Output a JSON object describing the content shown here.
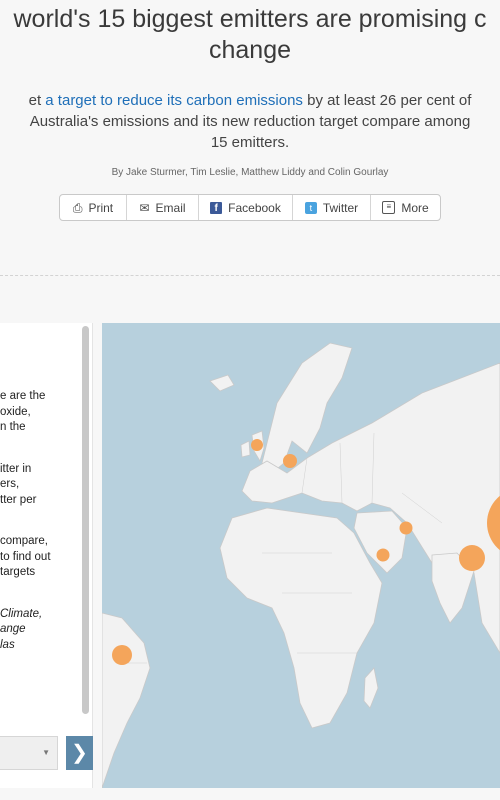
{
  "header": {
    "title_line1": "world's 15 biggest emitters are promising c",
    "title_line2": "change",
    "intro_pre": "et ",
    "intro_link": "a target to reduce its carbon emissions",
    "intro_post": " by at least 26 per cent of",
    "intro_line2": "Australia's emissions and its new reduction target compare among",
    "intro_line3": "15 emitters.",
    "byline": "By Jake Sturmer, Tim Leslie, Matthew Liddy and Colin Gourlay"
  },
  "share": {
    "buttons": [
      {
        "label": "Print",
        "icon": "print-icon"
      },
      {
        "label": "Email",
        "icon": "envelope-icon"
      },
      {
        "label": "Facebook",
        "icon": "facebook-icon"
      },
      {
        "label": "Twitter",
        "icon": "twitter-icon"
      },
      {
        "label": "More",
        "icon": "more-icon"
      }
    ]
  },
  "panel": {
    "p1": [
      "e are the",
      "oxide,",
      "n the"
    ],
    "p2": [
      "itter in",
      "ers,",
      "tter per"
    ],
    "p3": [
      "compare,",
      "to find out",
      "targets"
    ],
    "p4": [
      "Climate,",
      "ange",
      "las"
    ],
    "next_glyph": "❯",
    "select_caret": "▼"
  },
  "map": {
    "land_color": "#f2f2f2",
    "water_color": "#b7d0dd",
    "marker_color": "#f4a55b",
    "markers": [
      {
        "name": "uk",
        "size": "small"
      },
      {
        "name": "germany",
        "size": "small"
      },
      {
        "name": "iran",
        "size": "small"
      },
      {
        "name": "saudi-arabia",
        "size": "small"
      },
      {
        "name": "india",
        "size": "medium"
      },
      {
        "name": "china",
        "size": "large"
      },
      {
        "name": "brazil",
        "size": "small"
      }
    ]
  }
}
